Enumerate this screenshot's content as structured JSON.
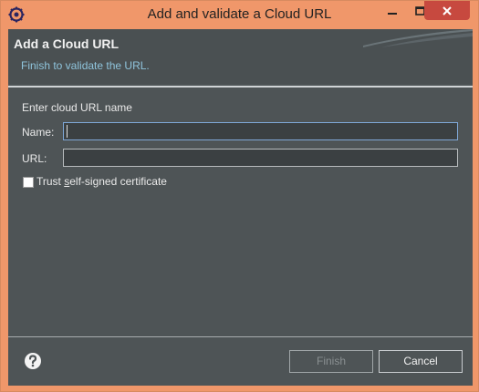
{
  "window": {
    "title": "Add and validate a Cloud URL",
    "minimize_glyph": "–",
    "maximize_glyph": "□",
    "close_glyph": "✕",
    "app_icon": "eclipse-gear-icon"
  },
  "header": {
    "title": "Add a Cloud URL",
    "message": "Finish to validate the URL."
  },
  "form": {
    "group_label": "Enter cloud URL name",
    "name_label": "Name:",
    "name_value": "",
    "url_label": "URL:",
    "url_value": "",
    "trust_label_prefix": "Trust ",
    "trust_label_mnemonic": "s",
    "trust_label_rest": "elf-signed certificate",
    "trust_checked": false
  },
  "footer": {
    "help_icon": "help-question-icon",
    "finish_label": "Finish",
    "finish_enabled": false,
    "cancel_label": "Cancel"
  },
  "colors": {
    "frame": "#f0976a",
    "client_bg": "#4e5456",
    "close_button": "#c7493f",
    "header_message": "#8fc4dc"
  }
}
